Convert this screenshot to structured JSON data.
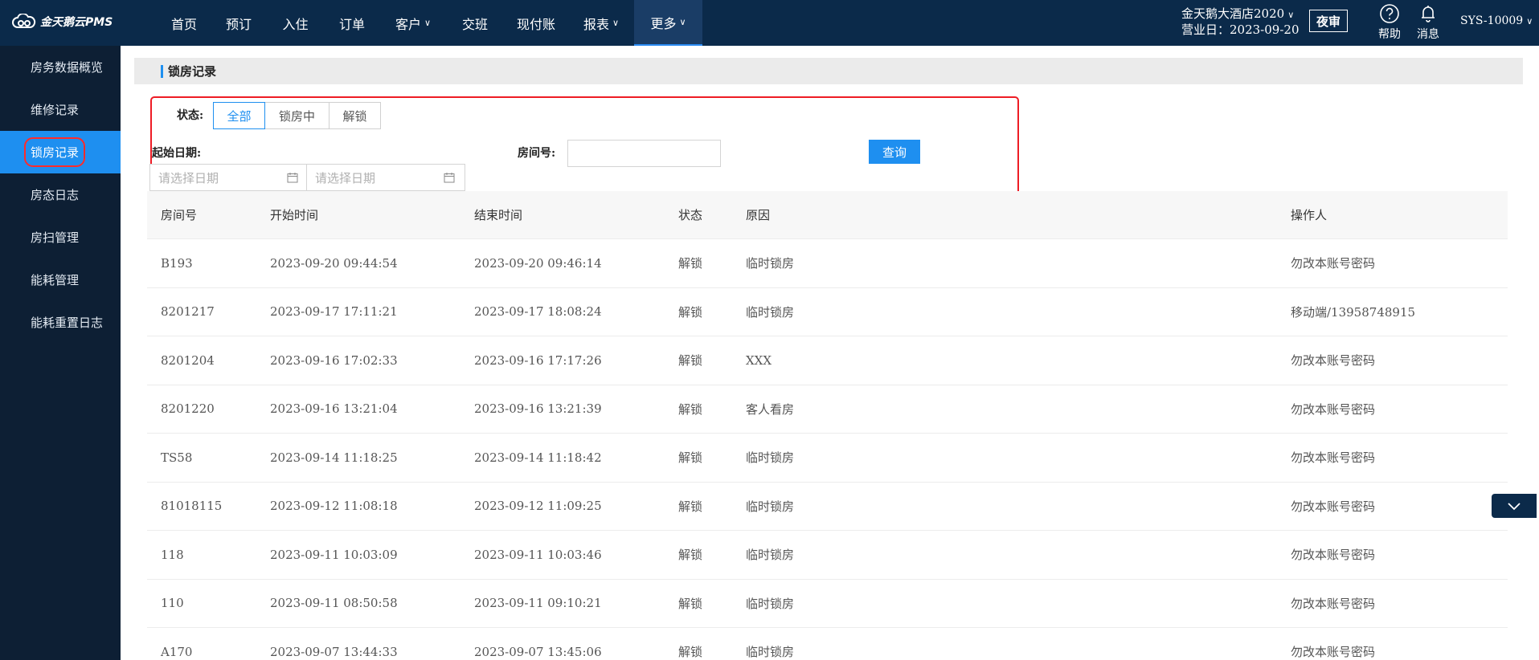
{
  "app": {
    "logo_text": "金天鹅云PMS"
  },
  "nav": {
    "items": [
      {
        "label": "首页",
        "dropdown": false,
        "active": false
      },
      {
        "label": "预订",
        "dropdown": false,
        "active": false
      },
      {
        "label": "入住",
        "dropdown": false,
        "active": false
      },
      {
        "label": "订单",
        "dropdown": false,
        "active": false
      },
      {
        "label": "客户",
        "dropdown": true,
        "active": false
      },
      {
        "label": "交班",
        "dropdown": false,
        "active": false
      },
      {
        "label": "现付账",
        "dropdown": false,
        "active": false
      },
      {
        "label": "报表",
        "dropdown": true,
        "active": false
      },
      {
        "label": "更多",
        "dropdown": true,
        "active": true
      }
    ],
    "hotel_name": "金天鹅大酒店2020",
    "business_date": "营业日：2023-09-20",
    "night_audit": "夜审",
    "help": "帮助",
    "messages": "消息",
    "user": "SYS-10009"
  },
  "sidebar": {
    "items": [
      {
        "label": "房务数据概览",
        "active": false
      },
      {
        "label": "维修记录",
        "active": false
      },
      {
        "label": "锁房记录",
        "active": true
      },
      {
        "label": "房态日志",
        "active": false
      },
      {
        "label": "房扫管理",
        "active": false
      },
      {
        "label": "能耗管理",
        "active": false
      },
      {
        "label": "能耗重置日志",
        "active": false
      }
    ]
  },
  "section": {
    "title": "锁房记录"
  },
  "filters": {
    "status_label": "状态:",
    "status_options": [
      "全部",
      "锁房中",
      "解锁"
    ],
    "status_selected": "全部",
    "start_date_label": "起始日期:",
    "start_placeholder": "请选择日期",
    "end_placeholder": "请选择日期",
    "room_label": "房间号:",
    "room_value": "",
    "query_button": "查询"
  },
  "table": {
    "headers": [
      "房间号",
      "开始时间",
      "结束时间",
      "状态",
      "原因",
      "操作人"
    ],
    "rows": [
      [
        "B193",
        "2023-09-20 09:44:54",
        "2023-09-20 09:46:14",
        "解锁",
        "临时锁房",
        "勿改本账号密码"
      ],
      [
        "8201217",
        "2023-09-17 17:11:21",
        "2023-09-17 18:08:24",
        "解锁",
        "临时锁房",
        "移动端/13958748915"
      ],
      [
        "8201204",
        "2023-09-16 17:02:33",
        "2023-09-16 17:17:26",
        "解锁",
        "XXX",
        "勿改本账号密码"
      ],
      [
        "8201220",
        "2023-09-16 13:21:04",
        "2023-09-16 13:21:39",
        "解锁",
        "客人看房",
        "勿改本账号密码"
      ],
      [
        "TS58",
        "2023-09-14 11:18:25",
        "2023-09-14 11:18:42",
        "解锁",
        "临时锁房",
        "勿改本账号密码"
      ],
      [
        "81018115",
        "2023-09-12 11:08:18",
        "2023-09-12 11:09:25",
        "解锁",
        "临时锁房",
        "勿改本账号密码"
      ],
      [
        "118",
        "2023-09-11 10:03:09",
        "2023-09-11 10:03:46",
        "解锁",
        "临时锁房",
        "勿改本账号密码"
      ],
      [
        "110",
        "2023-09-11 08:50:58",
        "2023-09-11 09:10:21",
        "解锁",
        "临时锁房",
        "勿改本账号密码"
      ],
      [
        "A170",
        "2023-09-07 13:44:33",
        "2023-09-07 13:45:06",
        "解锁",
        "临时锁房",
        "勿改本账号密码"
      ]
    ]
  },
  "colors": {
    "topbar": "#0b2a4a",
    "sidebar": "#0d1f34",
    "accent": "#1e8ff0",
    "highlight": "#ee1c25"
  },
  "icons": {
    "logo": "cloud-logo-icon",
    "help": "question-circle-icon",
    "messages": "bell-icon",
    "calendar": "calendar-icon",
    "collapse": "chevron-down-icon"
  }
}
